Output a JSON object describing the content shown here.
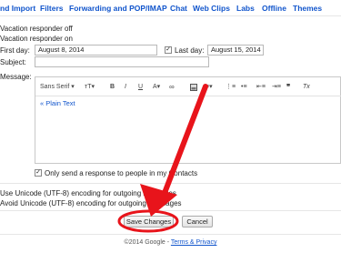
{
  "tabs": [
    "nd Import",
    "Filters",
    "Forwarding and POP/IMAP",
    "Chat",
    "Web Clips",
    "Labs",
    "Offline",
    "Themes"
  ],
  "vacation": {
    "off_label": "Vacation responder off",
    "on_label": "Vacation responder on",
    "first_day_label": "First day:",
    "first_day_value": "August 8, 2014",
    "last_day_checked": true,
    "last_day_label": "Last day:",
    "last_day_value": "August 15, 2014",
    "subject_label": "Subject:",
    "subject_value": "",
    "message_label": "Message:"
  },
  "toolbar": {
    "font": "Sans Serif",
    "size": "тT",
    "bold": "B",
    "italic": "I",
    "underline": "U",
    "text_color": "A",
    "remove_format": "Tx"
  },
  "editor": {
    "plain_text_link": "« Plain Text"
  },
  "contacts_only": {
    "checked": true,
    "label": "Only send a response to people in my Contacts"
  },
  "encoding": {
    "unicode_label": "Use Unicode (UTF-8) encoding for outgoing messages",
    "avoid_label": "Avoid Unicode (UTF-8) encoding for outgoing messages"
  },
  "buttons": {
    "save": "Save Changes",
    "cancel": "Cancel"
  },
  "footer": {
    "copyright": "©2014 Google -",
    "terms": "Terms & Privacy"
  },
  "colors": {
    "link": "#1155cc",
    "annotation": "#e8141b"
  }
}
